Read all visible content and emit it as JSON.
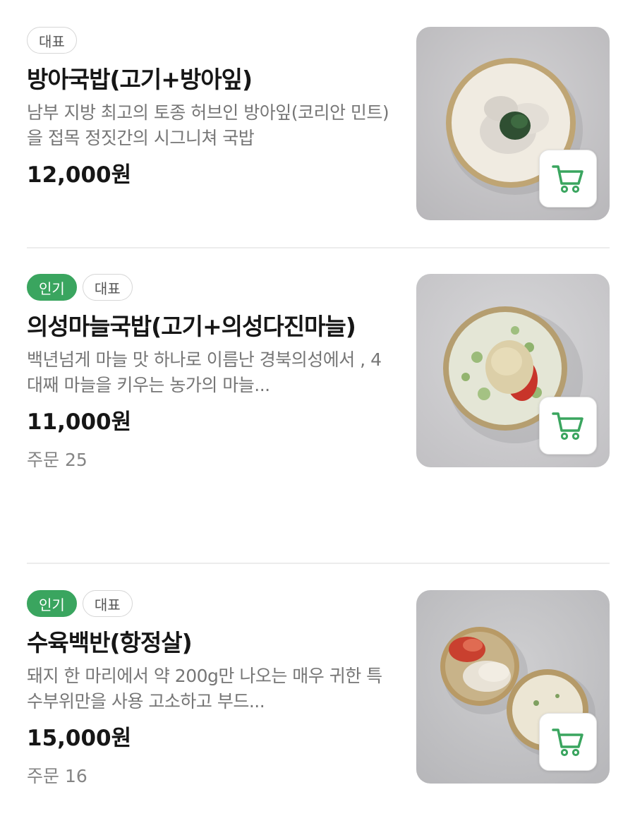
{
  "badge_labels": {
    "popular": "인기",
    "representative": "대표"
  },
  "colors": {
    "accent": "#3aa55f"
  },
  "items": [
    {
      "name": "방아국밥(고기+방아잎)",
      "description": "남부 지방 최고의 토종 허브인 방아잎(코리안 민트)을 접목 정짓간의 시그니쳐 국밥",
      "price": "12,000원",
      "orders": ""
    },
    {
      "name": "의성마늘국밥(고기+의성다진마늘)",
      "description": "백년넘게 마늘 맛 하나로 이름난 경북의성에서 , 4대째 마늘을 키우는 농가의 마늘...",
      "price": "11,000원",
      "orders": "주문 25"
    },
    {
      "name": "수육백반(항정살)",
      "description": "돼지 한 마리에서 약 200g만 나오는 매우 귀한 특수부위만을 사용 고소하고 부드...",
      "price": "15,000원",
      "orders": "주문 16"
    }
  ],
  "icons": {
    "cart": "cart-icon"
  }
}
